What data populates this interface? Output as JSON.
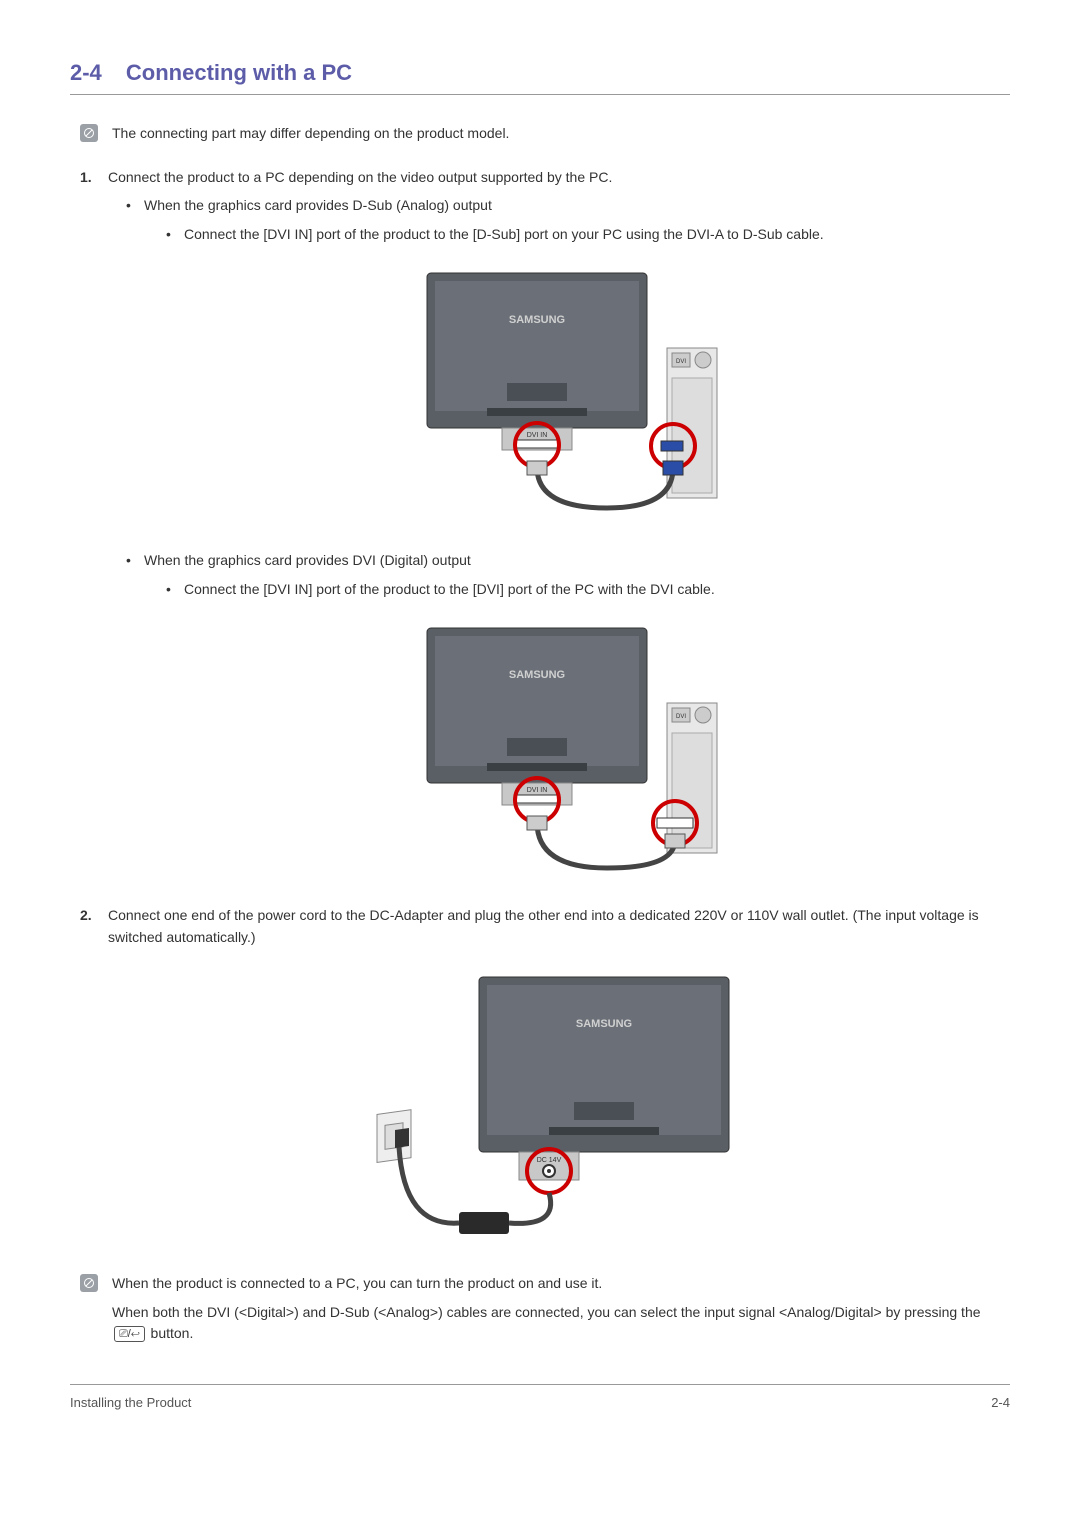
{
  "heading": {
    "number": "2-4",
    "title": "Connecting with a PC"
  },
  "note1": "The connecting part may differ depending on the product model.",
  "step1": {
    "text": "Connect the product to a PC depending on the video output supported by the PC.",
    "dsub": {
      "title": "When the graphics card provides D-Sub (Analog) output",
      "detail": "Connect the [DVI IN] port of the product to the [D-Sub] port on your PC using the DVI-A to D-Sub cable."
    },
    "dvi": {
      "title": "When the graphics card provides DVI (Digital) output",
      "detail": "Connect the [DVI IN] port of the product to the [DVI] port of the PC with the DVI cable."
    }
  },
  "step2": {
    "text": "Connect one end of the power cord to the DC-Adapter and plug the other end into a dedicated 220V or 110V wall outlet. (The input voltage is switched automatically.)"
  },
  "note2": {
    "line1": "When the product is connected to a PC, you can turn the product on and use it.",
    "line2a": "When both the DVI (<Digital>) and D-Sub (<Analog>) cables are connected, you can select the input signal <Analog/Digital> by pressing the ",
    "line2b": " button."
  },
  "figure_labels": {
    "monitor_brand": "SAMSUNG",
    "dvi_port": "DVI IN",
    "dvi_card": "DVI",
    "dc_port": "DC 14V"
  },
  "button_glyph": "⎚/↩",
  "footer": {
    "left": "Installing the Product",
    "right": "2-4"
  }
}
